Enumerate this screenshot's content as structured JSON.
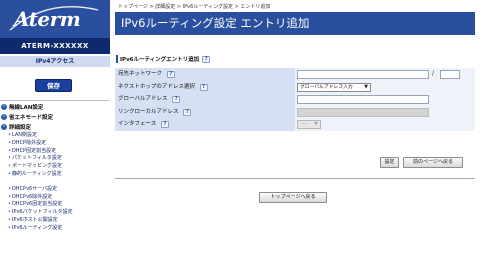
{
  "brand": {
    "logo_text": "Aterm"
  },
  "sidebar": {
    "model": "ATERM-XXXXXX",
    "mode": "IPv4アクセス",
    "save_label": "保存",
    "sections": [
      {
        "title": "無線LAN設定",
        "items": []
      },
      {
        "title": "省エネモード設定",
        "items": []
      },
      {
        "title": "詳細設定",
        "items": [
          "LAN側設定",
          "DHCP除外設定",
          "DHCP固定割当設定",
          "パケットフィルタ設定",
          "ポートマッピング設定",
          "静的ルーティング設定"
        ]
      }
    ],
    "items2": [
      "DHCPv6サーバ設定",
      "DHCPv6除外設定",
      "DHCPv6固定割当設定",
      "IPv6パケットフィルタ設定",
      "IPv6ホスト公開設定",
      "IPv6ルーティング設定"
    ]
  },
  "breadcrumb": "トップページ > 詳細設定 > IPv6ルーティング設定 > エントリ追加",
  "page_title": "IPv6ルーティング設定 エントリ追加",
  "section_title": "IPv6ルーティングエントリ追加",
  "help_mark": "?",
  "form": {
    "dest_label": "宛先ネットワーク",
    "dest_value": "",
    "prefix_slash": "/",
    "prefix_value": "",
    "nexthop_label": "ネクストホップのアドレス選択",
    "nexthop_selected": "グローバルアドレス入力",
    "global_label": "グローバルアドレス",
    "global_value": "",
    "linklocal_label": "リンクローカルアドレス",
    "linklocal_value": "",
    "iface_label": "インタフェース",
    "iface_selected": "-----"
  },
  "buttons": {
    "set": "設定",
    "back": "前のページへ戻る",
    "top": "トップページへ戻る"
  },
  "colors": {
    "accent": "#2a4f9e",
    "accent_dark": "#0d2a6e",
    "label_bg": "#d6e0f3"
  }
}
